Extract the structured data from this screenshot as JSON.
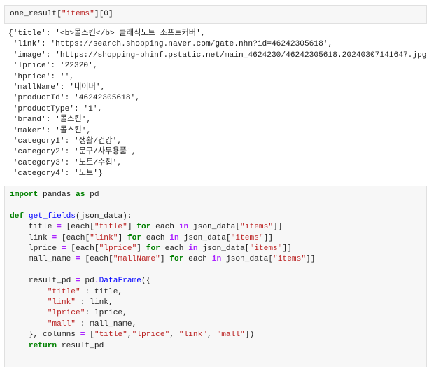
{
  "cell1": {
    "code": [
      [
        {
          "t": "one_result[",
          "c": "p"
        },
        {
          "t": "\"items\"",
          "c": "str"
        },
        {
          "t": "][0]",
          "c": "p"
        }
      ]
    ]
  },
  "output1": {
    "lines": [
      "{'title': '<b>몰스킨</b> 클래식노트 소프트커버',",
      " 'link': 'https://search.shopping.naver.com/gate.nhn?id=46242305618',",
      " 'image': 'https://shopping-phinf.pstatic.net/main_4624230/46242305618.20240307141647.jpg',",
      " 'lprice': '22320',",
      " 'hprice': '',",
      " 'mallName': '네이버',",
      " 'productId': '46242305618',",
      " 'productType': '1',",
      " 'brand': '몰스킨',",
      " 'maker': '몰스킨',",
      " 'category1': '생활/건강',",
      " 'category2': '문구/사무용품',",
      " 'category3': '노트/수첩',",
      " 'category4': '노트'}"
    ]
  },
  "cell2": {
    "code": [
      [
        {
          "t": "import",
          "c": "kw"
        },
        {
          "t": " pandas ",
          "c": "p"
        },
        {
          "t": "as",
          "c": "kw"
        },
        {
          "t": " pd",
          "c": "p"
        }
      ],
      [],
      [
        {
          "t": "def",
          "c": "kw"
        },
        {
          "t": " ",
          "c": "p"
        },
        {
          "t": "get_fields",
          "c": "fn"
        },
        {
          "t": "(json_data):",
          "c": "p"
        }
      ],
      [
        {
          "t": "    title ",
          "c": "p"
        },
        {
          "t": "=",
          "c": "op"
        },
        {
          "t": " [each[",
          "c": "p"
        },
        {
          "t": "\"title\"",
          "c": "str"
        },
        {
          "t": "] ",
          "c": "p"
        },
        {
          "t": "for",
          "c": "kw"
        },
        {
          "t": " each ",
          "c": "p"
        },
        {
          "t": "in",
          "c": "op"
        },
        {
          "t": " json_data[",
          "c": "p"
        },
        {
          "t": "\"items\"",
          "c": "str"
        },
        {
          "t": "]]",
          "c": "p"
        }
      ],
      [
        {
          "t": "    link ",
          "c": "p"
        },
        {
          "t": "=",
          "c": "op"
        },
        {
          "t": " [each[",
          "c": "p"
        },
        {
          "t": "\"link\"",
          "c": "str"
        },
        {
          "t": "] ",
          "c": "p"
        },
        {
          "t": "for",
          "c": "kw"
        },
        {
          "t": " each ",
          "c": "p"
        },
        {
          "t": "in",
          "c": "op"
        },
        {
          "t": " json_data[",
          "c": "p"
        },
        {
          "t": "\"items\"",
          "c": "str"
        },
        {
          "t": "]]",
          "c": "p"
        }
      ],
      [
        {
          "t": "    lprice ",
          "c": "p"
        },
        {
          "t": "=",
          "c": "op"
        },
        {
          "t": " [each[",
          "c": "p"
        },
        {
          "t": "\"lprice\"",
          "c": "str"
        },
        {
          "t": "] ",
          "c": "p"
        },
        {
          "t": "for",
          "c": "kw"
        },
        {
          "t": " each ",
          "c": "p"
        },
        {
          "t": "in",
          "c": "op"
        },
        {
          "t": " json_data[",
          "c": "p"
        },
        {
          "t": "\"items\"",
          "c": "str"
        },
        {
          "t": "]]",
          "c": "p"
        }
      ],
      [
        {
          "t": "    mall_name ",
          "c": "p"
        },
        {
          "t": "=",
          "c": "op"
        },
        {
          "t": " [each[",
          "c": "p"
        },
        {
          "t": "\"mallName\"",
          "c": "str"
        },
        {
          "t": "] ",
          "c": "p"
        },
        {
          "t": "for",
          "c": "kw"
        },
        {
          "t": " each ",
          "c": "p"
        },
        {
          "t": "in",
          "c": "op"
        },
        {
          "t": " json_data[",
          "c": "p"
        },
        {
          "t": "\"items\"",
          "c": "str"
        },
        {
          "t": "]]",
          "c": "p"
        }
      ],
      [],
      [
        {
          "t": "    result_pd ",
          "c": "p"
        },
        {
          "t": "=",
          "c": "op"
        },
        {
          "t": " pd",
          "c": "p"
        },
        {
          "t": ".",
          "c": "op"
        },
        {
          "t": "DataFrame",
          "c": "fn"
        },
        {
          "t": "({",
          "c": "p"
        }
      ],
      [
        {
          "t": "        ",
          "c": "p"
        },
        {
          "t": "\"title\"",
          "c": "str"
        },
        {
          "t": " : title,",
          "c": "p"
        }
      ],
      [
        {
          "t": "        ",
          "c": "p"
        },
        {
          "t": "\"link\"",
          "c": "str"
        },
        {
          "t": " : link,",
          "c": "p"
        }
      ],
      [
        {
          "t": "        ",
          "c": "p"
        },
        {
          "t": "\"lprice\"",
          "c": "str"
        },
        {
          "t": ": lprice,",
          "c": "p"
        }
      ],
      [
        {
          "t": "        ",
          "c": "p"
        },
        {
          "t": "\"mall\"",
          "c": "str"
        },
        {
          "t": " : mall_name,",
          "c": "p"
        }
      ],
      [
        {
          "t": "    }, columns ",
          "c": "p"
        },
        {
          "t": "=",
          "c": "op"
        },
        {
          "t": " [",
          "c": "p"
        },
        {
          "t": "\"title\"",
          "c": "str"
        },
        {
          "t": ",",
          "c": "p"
        },
        {
          "t": "\"lprice\"",
          "c": "str"
        },
        {
          "t": ", ",
          "c": "p"
        },
        {
          "t": "\"link\"",
          "c": "str"
        },
        {
          "t": ", ",
          "c": "p"
        },
        {
          "t": "\"mall\"",
          "c": "str"
        },
        {
          "t": "])",
          "c": "p"
        }
      ],
      [
        {
          "t": "    ",
          "c": "p"
        },
        {
          "t": "return",
          "c": "kw"
        },
        {
          "t": " result_pd",
          "c": "p"
        }
      ]
    ]
  }
}
